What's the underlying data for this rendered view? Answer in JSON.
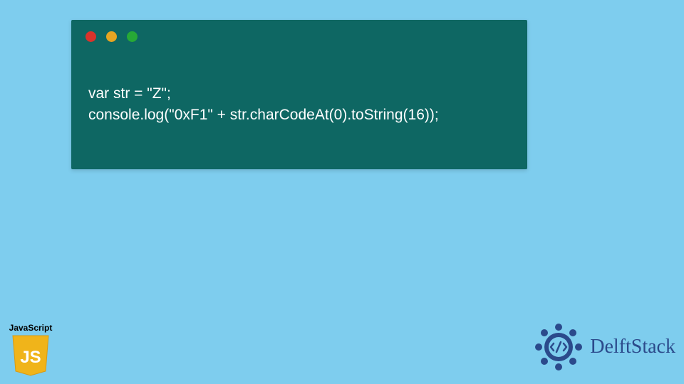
{
  "code": {
    "line1": "var str = \"Z\";",
    "line2": "console.log(\"0xF1\" + str.charCodeAt(0).toString(16));"
  },
  "js_badge": {
    "label": "JavaScript",
    "short": "JS"
  },
  "delft": {
    "brand": "DelftStack"
  },
  "colors": {
    "page_bg": "#7ecdee",
    "window_bg": "#0e6763",
    "brand_blue": "#2b4a8b",
    "js_yellow": "#f0b41a"
  }
}
